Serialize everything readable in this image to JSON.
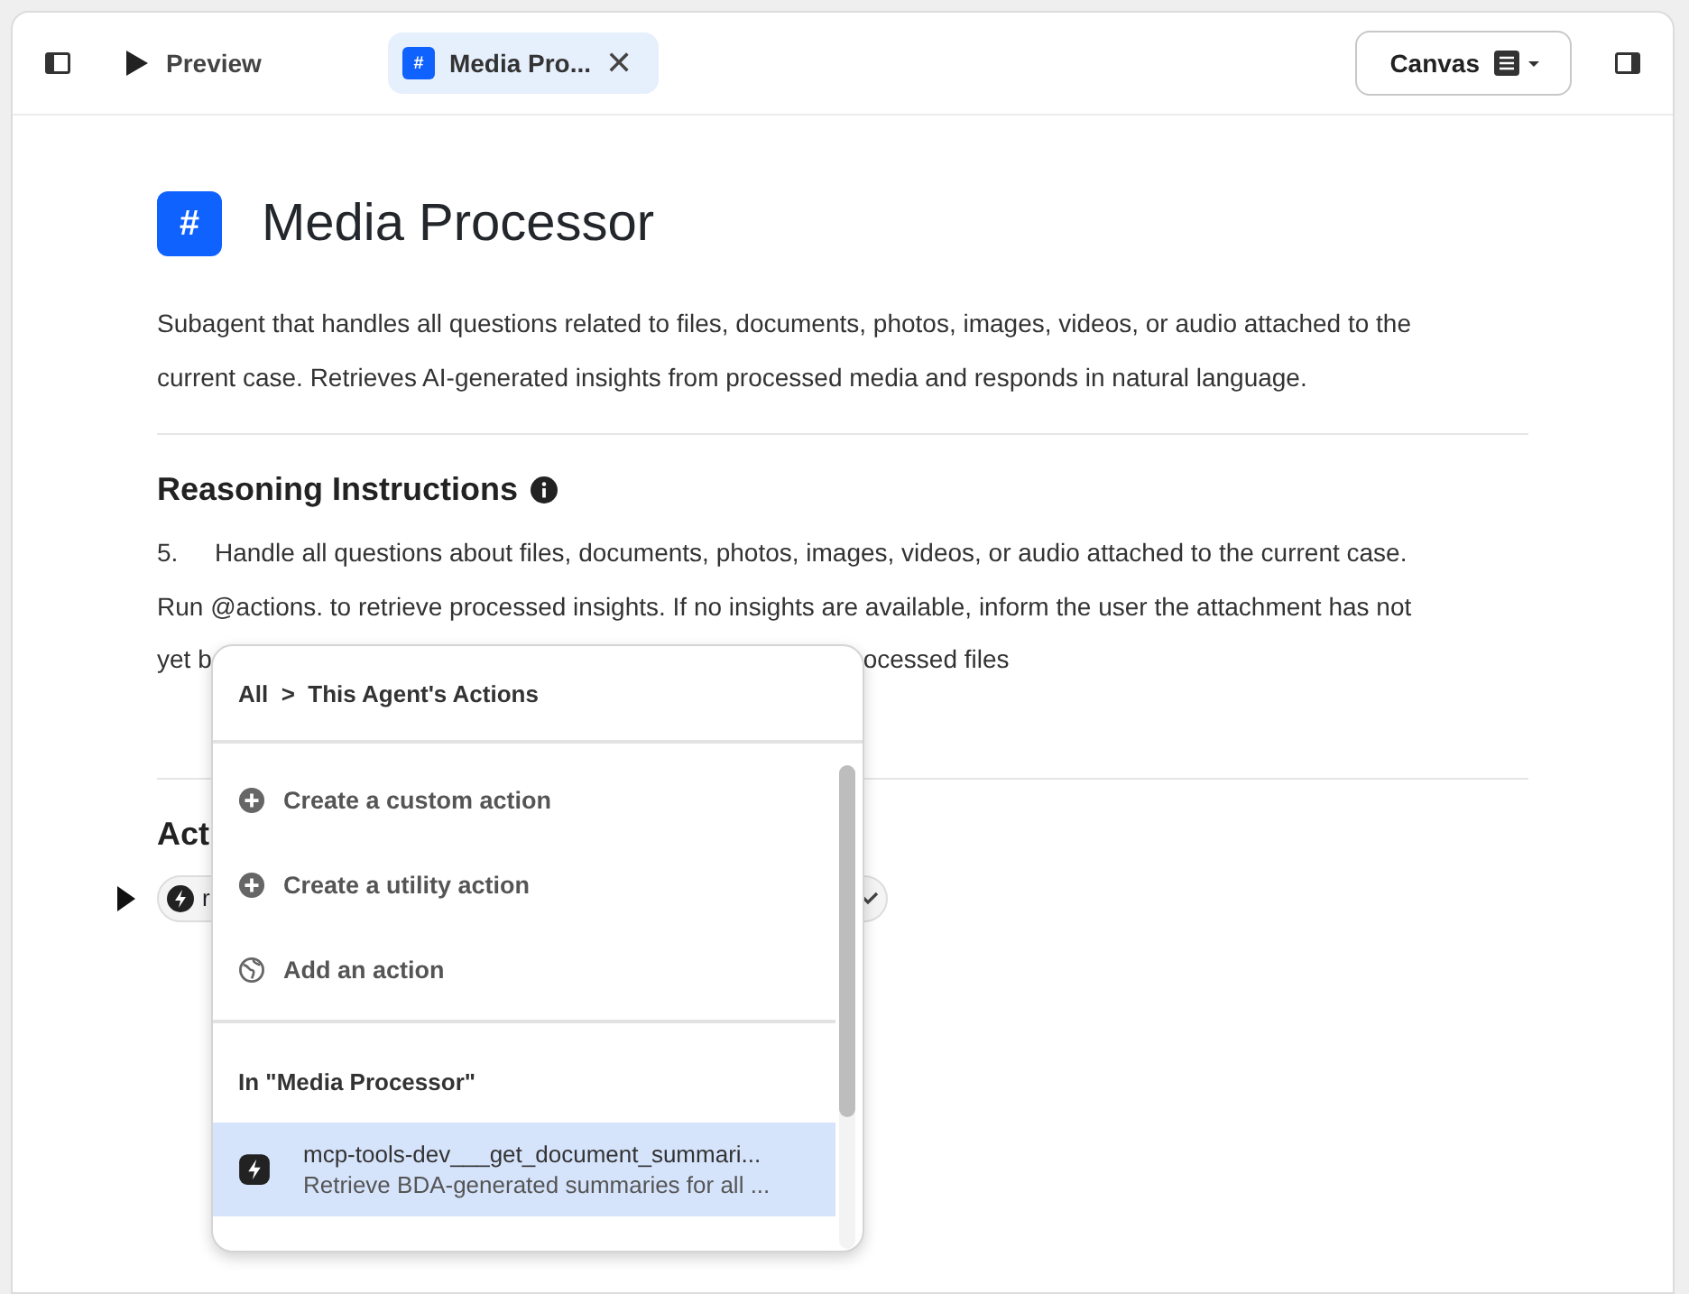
{
  "toolbar": {
    "preview_label": "Preview",
    "tabs": [
      {
        "label": "Media Pro...",
        "selected": true,
        "close_glyph": "✕"
      }
    ],
    "canvas_button": "Canvas"
  },
  "agent": {
    "icon_text": "#",
    "title": "Media Processor",
    "description": "Subagent that handles all questions related to files, documents, photos, images, videos, or audio attached to the current case. Retrieves AI-generated insights from processed media and responds in natural language."
  },
  "reasoning": {
    "heading": "Reasoning Instructions",
    "number": "5.",
    "lines": [
      "Handle all questions about files, documents, photos, images, videos, or audio attached to the current case.",
      "Run @actions. to retrieve processed insights. If no insights are available, inform the user the attachment has not"
    ],
    "partial_line": [
      "yet b",
      "ocessed files"
    ]
  },
  "actions": {
    "heading": "Act",
    "chip_text": "r",
    "expanded": false
  },
  "popup": {
    "breadcrumb": [
      "All",
      "This Agent's Actions"
    ],
    "separator": ">",
    "menu": [
      {
        "label": "Create a custom action",
        "kind": "plus"
      },
      {
        "label": "Create a utility action",
        "kind": "plus"
      },
      {
        "label": "Add an action",
        "kind": "globe"
      }
    ],
    "section_label": "In \"Media Processor\"",
    "items": [
      {
        "name": "mcp-tools-dev___get_document_summari...",
        "description": "Retrieve BDA-generated summaries for all ...",
        "selected": true
      }
    ]
  }
}
